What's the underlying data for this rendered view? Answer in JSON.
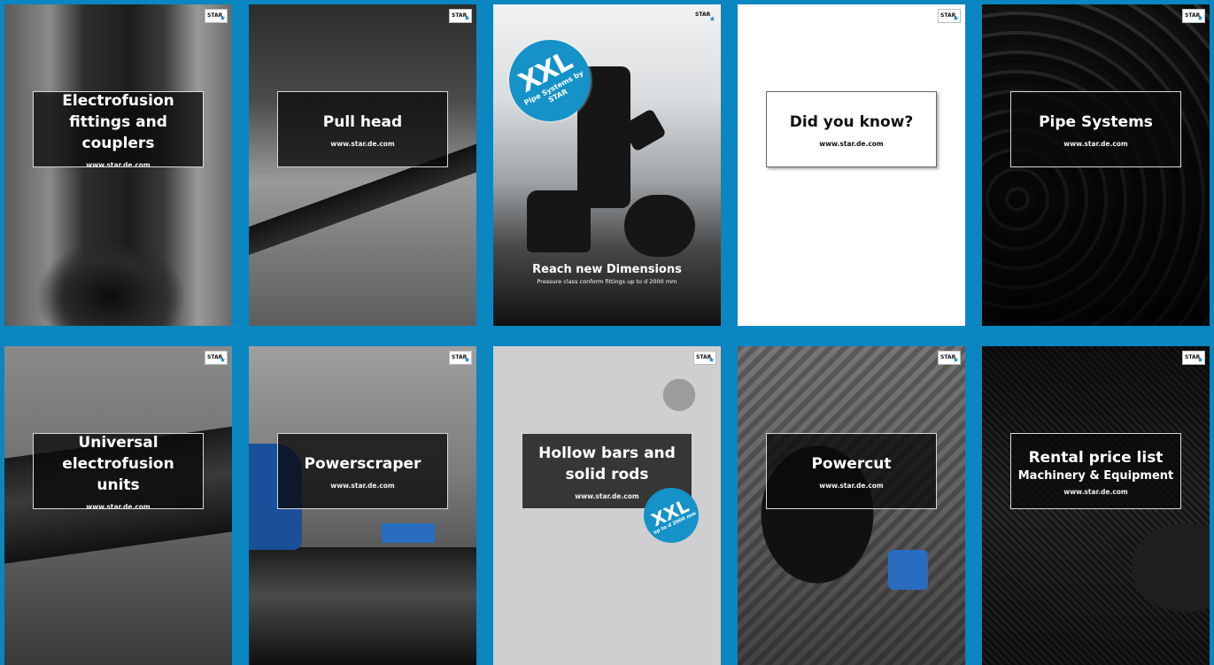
{
  "brand": {
    "logo_text": "STAR",
    "accent": "#0a86c0"
  },
  "cards": [
    {
      "title": "Electrofusion fittings and couplers",
      "url": "www.star.de.com"
    },
    {
      "title": "Pull head",
      "url": "www.star.de.com"
    },
    {
      "badge_big": "XXL",
      "badge_small": "Pipe Systems by STAR",
      "headline": "Reach new Dimensions",
      "subline": "Pressure class conform fittings up to d 2000 mm"
    },
    {
      "title": "Did you know?",
      "url": "www.star.de.com"
    },
    {
      "title": "Pipe Systems",
      "url": "www.star.de.com"
    },
    {
      "title": "Universal electrofusion units",
      "url": "www.star.de.com"
    },
    {
      "title": "Powerscraper",
      "url": "www.star.de.com"
    },
    {
      "title": "Hollow bars and solid rods",
      "url": "www.star.de.com",
      "badge_big": "XXL",
      "badge_small": "up to d 2000 mm"
    },
    {
      "title": "Powercut",
      "url": "www.star.de.com"
    },
    {
      "title": "Rental price list",
      "subtitle": "Machinery & Equipment",
      "url": "www.star.de.com"
    }
  ]
}
